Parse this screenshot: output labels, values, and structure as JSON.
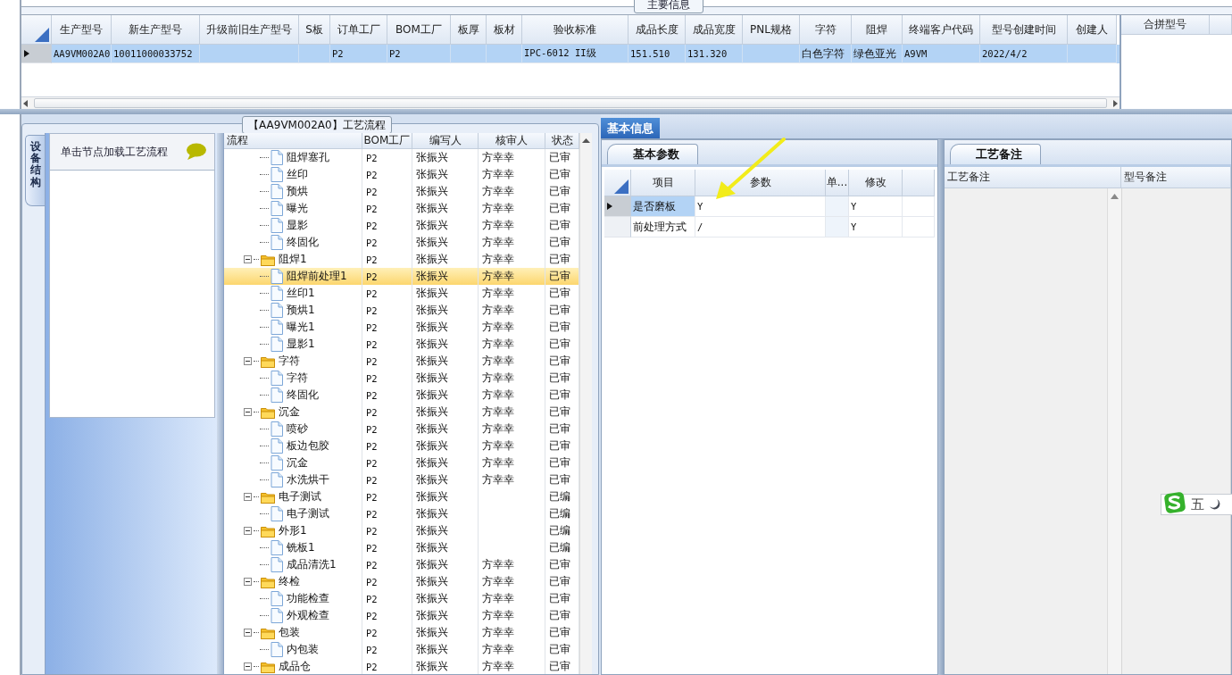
{
  "main_info": {
    "title": "主要信息",
    "columns": [
      "生产型号",
      "新生产型号",
      "升级前旧生产型号",
      "S板",
      "订单工厂",
      "BOM工厂",
      "板厚",
      "板材",
      "验收标准",
      "成品长度",
      "成品宽度",
      "PNL规格",
      "字符",
      "阻焊",
      "终端客户代码",
      "型号创建时间",
      "创建人"
    ],
    "rows": [
      {
        "selected": true,
        "cells": [
          "AA9VM002A0",
          "10011000033752",
          null,
          null,
          "P2",
          "P2",
          null,
          null,
          "IPC-6012 II级",
          "151.510",
          "131.320",
          null,
          "白色字符",
          "绿色亚光",
          "A9VM",
          "2022/4/2",
          null
        ]
      }
    ],
    "merge_columns": [
      "合拼型号"
    ]
  },
  "process_flow": {
    "title": "【AA9VM002A0】工艺流程",
    "side_tab": "设备结构",
    "hint": "单击节点加载工艺流程",
    "columns": [
      "流程",
      "BOM工厂",
      "编写人",
      "核审人",
      "状态"
    ],
    "tree": [
      {
        "kind": "step",
        "name": "阻焊塞孔",
        "bom": "P2",
        "writer": "张振兴",
        "reviewer": "方幸幸",
        "status": "已审",
        "selected": false
      },
      {
        "kind": "step",
        "name": "丝印",
        "bom": "P2",
        "writer": "张振兴",
        "reviewer": "方幸幸",
        "status": "已审",
        "selected": false
      },
      {
        "kind": "step",
        "name": "预烘",
        "bom": "P2",
        "writer": "张振兴",
        "reviewer": "方幸幸",
        "status": "已审",
        "selected": false
      },
      {
        "kind": "step",
        "name": "曝光",
        "bom": "P2",
        "writer": "张振兴",
        "reviewer": "方幸幸",
        "status": "已审",
        "selected": false
      },
      {
        "kind": "step",
        "name": "显影",
        "bom": "P2",
        "writer": "张振兴",
        "reviewer": "方幸幸",
        "status": "已审",
        "selected": false
      },
      {
        "kind": "step",
        "name": "终固化",
        "bom": "P2",
        "writer": "张振兴",
        "reviewer": "方幸幸",
        "status": "已审",
        "selected": false
      },
      {
        "kind": "group",
        "name": "阻焊1",
        "bom": "P2",
        "writer": "张振兴",
        "reviewer": "方幸幸",
        "status": "已审",
        "selected": false,
        "expanded": true,
        "children": [
          {
            "kind": "step",
            "name": "阻焊前处理1",
            "bom": "P2",
            "writer": "张振兴",
            "reviewer": "方幸幸",
            "status": "已审",
            "selected": true
          },
          {
            "kind": "step",
            "name": "丝印1",
            "bom": "P2",
            "writer": "张振兴",
            "reviewer": "方幸幸",
            "status": "已审",
            "selected": false
          },
          {
            "kind": "step",
            "name": "预烘1",
            "bom": "P2",
            "writer": "张振兴",
            "reviewer": "方幸幸",
            "status": "已审",
            "selected": false
          },
          {
            "kind": "step",
            "name": "曝光1",
            "bom": "P2",
            "writer": "张振兴",
            "reviewer": "方幸幸",
            "status": "已审",
            "selected": false
          },
          {
            "kind": "step",
            "name": "显影1",
            "bom": "P2",
            "writer": "张振兴",
            "reviewer": "方幸幸",
            "status": "已审",
            "selected": false
          }
        ]
      },
      {
        "kind": "group",
        "name": "字符",
        "bom": "P2",
        "writer": "张振兴",
        "reviewer": "方幸幸",
        "status": "已审",
        "selected": false,
        "expanded": true,
        "children": [
          {
            "kind": "step",
            "name": "字符",
            "bom": "P2",
            "writer": "张振兴",
            "reviewer": "方幸幸",
            "status": "已审",
            "selected": false
          },
          {
            "kind": "step",
            "name": "终固化",
            "bom": "P2",
            "writer": "张振兴",
            "reviewer": "方幸幸",
            "status": "已审",
            "selected": false
          }
        ]
      },
      {
        "kind": "group",
        "name": "沉金",
        "bom": "P2",
        "writer": "张振兴",
        "reviewer": "方幸幸",
        "status": "已审",
        "selected": false,
        "expanded": true,
        "children": [
          {
            "kind": "step",
            "name": "喷砂",
            "bom": "P2",
            "writer": "张振兴",
            "reviewer": "方幸幸",
            "status": "已审",
            "selected": false
          },
          {
            "kind": "step",
            "name": "板边包胶",
            "bom": "P2",
            "writer": "张振兴",
            "reviewer": "方幸幸",
            "status": "已审",
            "selected": false
          },
          {
            "kind": "step",
            "name": "沉金",
            "bom": "P2",
            "writer": "张振兴",
            "reviewer": "方幸幸",
            "status": "已审",
            "selected": false
          },
          {
            "kind": "step",
            "name": "水洗烘干",
            "bom": "P2",
            "writer": "张振兴",
            "reviewer": "方幸幸",
            "status": "已审",
            "selected": false
          }
        ]
      },
      {
        "kind": "group",
        "name": "电子测试",
        "bom": "P2",
        "writer": "张振兴",
        "status": "已编",
        "selected": false,
        "expanded": true,
        "children": [
          {
            "kind": "step",
            "name": "电子测试",
            "bom": "P2",
            "writer": "张振兴",
            "status": "已编",
            "selected": false
          }
        ]
      },
      {
        "kind": "group",
        "name": "外形1",
        "bom": "P2",
        "writer": "张振兴",
        "status": "已编",
        "selected": false,
        "expanded": true,
        "children": [
          {
            "kind": "step",
            "name": "铣板1",
            "bom": "P2",
            "writer": "张振兴",
            "status": "已编",
            "selected": false
          },
          {
            "kind": "step",
            "name": "成品清洗1",
            "bom": "P2",
            "writer": "张振兴",
            "reviewer": "方幸幸",
            "status": "已审",
            "selected": false
          }
        ]
      },
      {
        "kind": "group",
        "name": "终检",
        "bom": "P2",
        "writer": "张振兴",
        "reviewer": "方幸幸",
        "status": "已审",
        "selected": false,
        "expanded": true,
        "children": [
          {
            "kind": "step",
            "name": "功能检查",
            "bom": "P2",
            "writer": "张振兴",
            "reviewer": "方幸幸",
            "status": "已审",
            "selected": false
          },
          {
            "kind": "step",
            "name": "外观检查",
            "bom": "P2",
            "writer": "张振兴",
            "reviewer": "方幸幸",
            "status": "已审",
            "selected": false
          }
        ]
      },
      {
        "kind": "group",
        "name": "包装",
        "bom": "P2",
        "writer": "张振兴",
        "reviewer": "方幸幸",
        "status": "已审",
        "selected": false,
        "expanded": true,
        "children": [
          {
            "kind": "step",
            "name": "内包装",
            "bom": "P2",
            "writer": "张振兴",
            "reviewer": "方幸幸",
            "status": "已审",
            "selected": false
          }
        ]
      },
      {
        "kind": "group",
        "name": "成品仓",
        "bom": "P2",
        "writer": "张振兴",
        "reviewer": "方幸幸",
        "status": "已审",
        "selected": false,
        "expanded": true
      }
    ]
  },
  "detail": {
    "tabs": [
      {
        "label": "基本信息",
        "selected": true
      }
    ],
    "params": {
      "tab": "基本参数",
      "columns": [
        "项目",
        "参数",
        "单...",
        "修改"
      ],
      "rows": [
        {
          "selected": true,
          "item": "是否磨板",
          "value": "Y",
          "unit": null,
          "modify": "Y"
        },
        {
          "selected": false,
          "item": "前处理方式",
          "value": "/",
          "unit": null,
          "modify": "Y"
        }
      ]
    },
    "notes": {
      "tab": "工艺备注",
      "columns": [
        "工艺备注",
        "型号备注"
      ]
    }
  },
  "ime_toolbar": {
    "mode": "五"
  }
}
